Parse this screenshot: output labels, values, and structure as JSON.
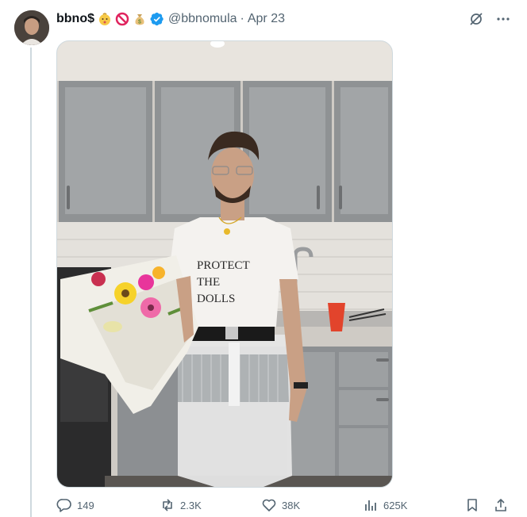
{
  "tweet": {
    "author_name": "bbno$",
    "name_emojis": [
      "baby-emoji",
      "prohibited-emoji",
      "money-bag-emoji"
    ],
    "handle": "@bbnomula",
    "separator": "·",
    "date": "Apr 23",
    "media": {
      "shirt_text": [
        "PROTECT",
        "THE",
        "DOLLS"
      ]
    },
    "stats": {
      "replies": "149",
      "reposts": "2.3K",
      "likes": "38K",
      "views": "625K"
    }
  },
  "colors": {
    "accent": "#1d9bf0",
    "secondary_text": "#536471",
    "border": "#cfd9de"
  },
  "icons": {
    "top_right": [
      "grok-icon",
      "more-icon"
    ],
    "actions": [
      "reply-icon",
      "repost-icon",
      "like-icon",
      "views-icon",
      "bookmark-icon",
      "share-icon"
    ]
  }
}
